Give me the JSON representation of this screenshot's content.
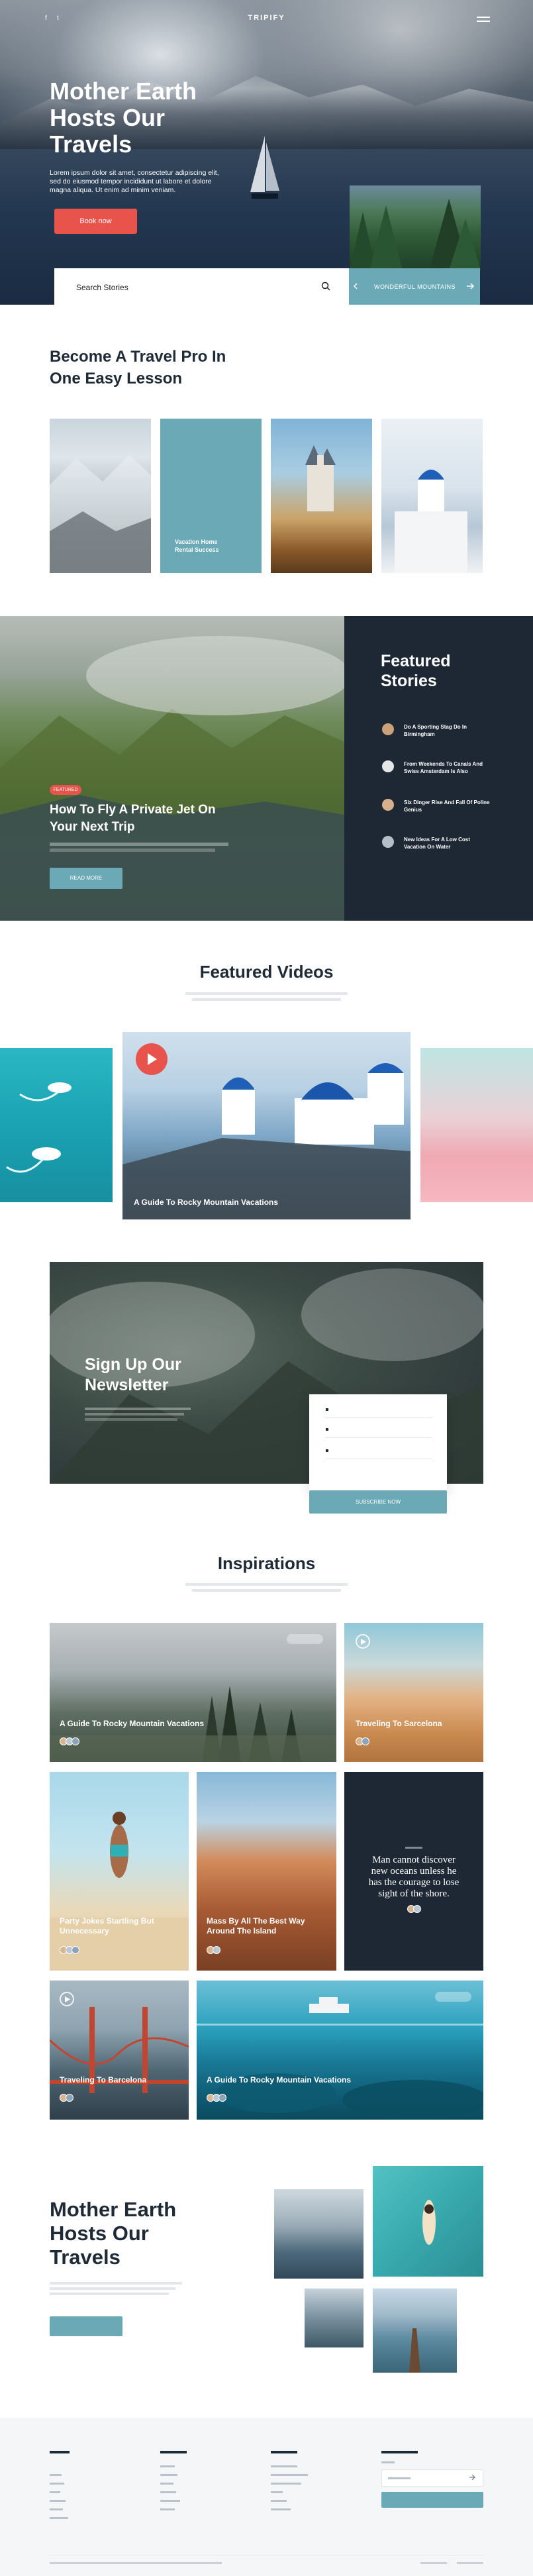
{
  "header": {
    "brand": "TRIPIFY",
    "social": [
      "f",
      "t"
    ]
  },
  "hero": {
    "title_lines": [
      "Mother Earth",
      "Hosts Our",
      "Travels"
    ],
    "description": "Lorem ipsum dolor sit amet, consectetur adipiscing elit, sed do eiusmod tempor incididunt ut labore et dolore magna aliqua. Ut enim ad minim veniam.",
    "cta": "Book now",
    "search_placeholder": "Search Stories",
    "side_card_label": "WONDERFUL MOUNTAINS"
  },
  "lesson": {
    "title_lines": [
      "Become A Travel Pro In",
      "One Easy Lesson"
    ],
    "card_caption_lines": [
      "Vacation Home",
      "Rental Success"
    ]
  },
  "featured_story": {
    "tag": "FEATURED",
    "title_lines": [
      "How To Fly A Private Jet On",
      "Your Next Trip"
    ],
    "button": "READ MORE",
    "sidebar_title_lines": [
      "Featured",
      "Stories"
    ],
    "stories": [
      {
        "title_lines": [
          "Do A Sporting Stag Do In",
          "Birmingham"
        ]
      },
      {
        "title_lines": [
          "From Weekends To Canals And",
          "Swiss Amsterdam Is Also"
        ]
      },
      {
        "title_lines": [
          "Six Dinger Rise And Fall Of Poline",
          "Genius"
        ]
      },
      {
        "title_lines": [
          "New Ideas For A Low Cost",
          "Vacation On Water"
        ]
      }
    ]
  },
  "featured_videos": {
    "title": "Featured Videos",
    "main_caption": "A Guide To Rocky Mountain Vacations"
  },
  "newsletter": {
    "title_lines": [
      "Sign Up Our",
      "Newsletter"
    ],
    "button": "SUBSCRIBE NOW"
  },
  "inspirations": {
    "title": "Inspirations",
    "cards": [
      {
        "title_lines": [
          "A Guide To Rocky Mountain Vacations"
        ]
      },
      {
        "title_lines": [
          "Traveling To Sarcelona"
        ]
      },
      {
        "title_lines": [
          "Party Jokes Startling But",
          "Unnecessary"
        ]
      },
      {
        "title_lines": [
          "Mass By All The Best Way",
          "Around The Island"
        ]
      },
      {
        "quote_lines": [
          "Man cannot discover",
          "new oceans unless he",
          "has the courage to lose",
          "sight of the shore."
        ]
      },
      {
        "title_lines": [
          "Traveling To Barcelona"
        ]
      },
      {
        "title_lines": [
          "A Guide To Rocky Mountain Vacations"
        ]
      }
    ]
  },
  "promo": {
    "title_lines": [
      "Mother Earth",
      "Hosts Our",
      "Travels"
    ]
  },
  "colors": {
    "accent_red": "#e8544b",
    "accent_teal": "#6aa9b5",
    "dark_navy": "#1e2834",
    "text_dark": "#1f2a37"
  }
}
